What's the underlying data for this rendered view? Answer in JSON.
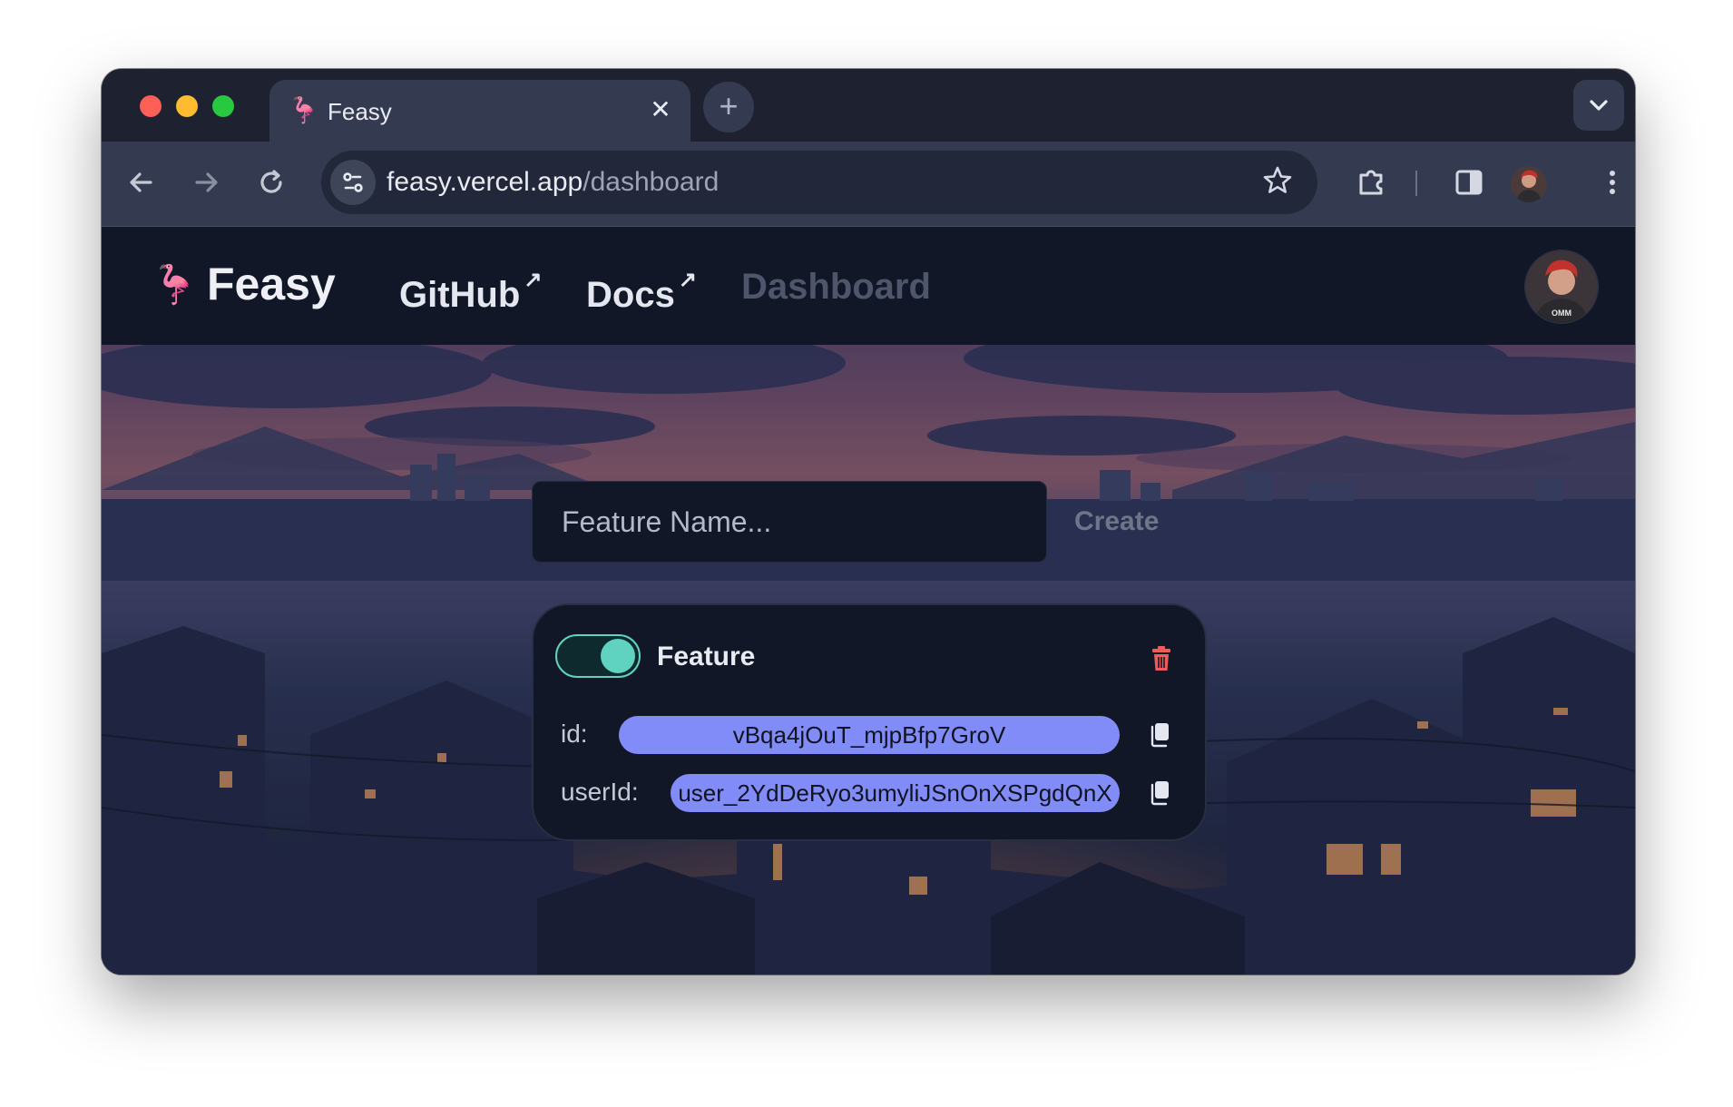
{
  "browser": {
    "tab": {
      "title": "Feasy",
      "close_glyph": "✕",
      "icon": "flamingo-icon"
    },
    "new_tab_glyph": "+",
    "url": {
      "host": "feasy.vercel.app",
      "path": "/dashboard"
    }
  },
  "nav": {
    "brand": "Feasy",
    "links": [
      {
        "label": "GitHub",
        "external_glyph": "↗"
      },
      {
        "label": "Docs",
        "external_glyph": "↗"
      },
      {
        "label": "Dashboard"
      }
    ]
  },
  "form": {
    "feature_name_placeholder": "Feature Name...",
    "create_label": "Create"
  },
  "feature_card": {
    "name": "Feature",
    "enabled": true,
    "id_label": "id:",
    "id_value": "vBqa4jOuT_mjpBfp7GroV",
    "user_id_label": "userId:",
    "user_id_value": "user_2YdDeRyo3umyliJSnOnXSPgdQnX"
  },
  "colors": {
    "accent_pill": "#818cf8",
    "toggle_on": "#5fd3c0",
    "delete": "#ef5a5a",
    "brand_pink": "#ef7fa5"
  }
}
